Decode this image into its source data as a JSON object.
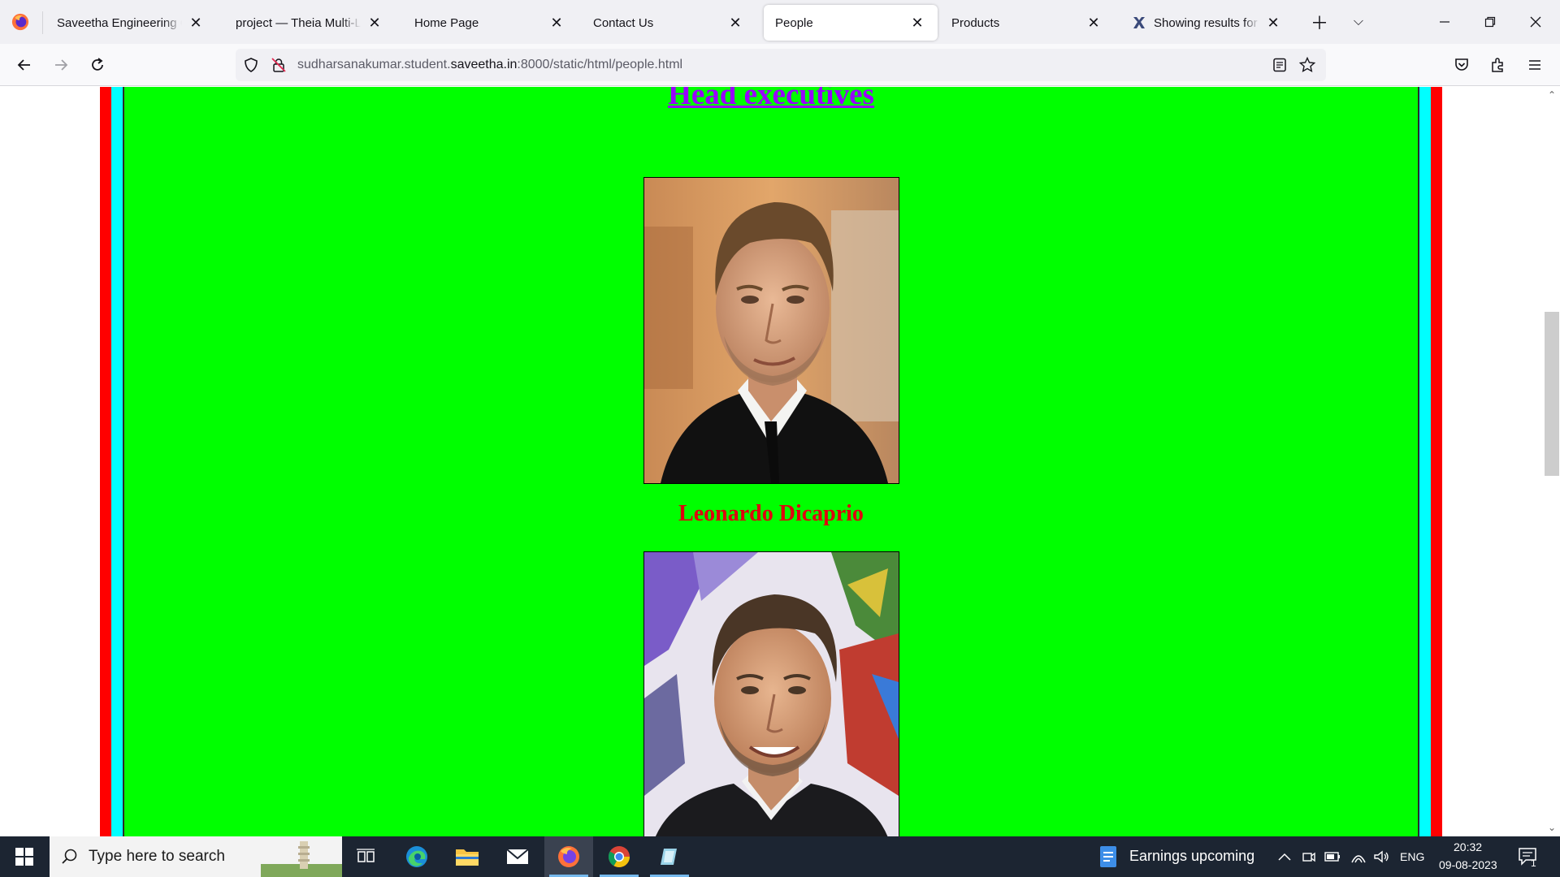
{
  "browser": {
    "tabs": [
      {
        "label": "Saveetha Engineering College",
        "active": false
      },
      {
        "label": "project — Theia Multi-Language",
        "active": false
      },
      {
        "label": "Home Page",
        "active": false
      },
      {
        "label": "Contact Us",
        "active": false
      },
      {
        "label": "People",
        "active": true
      },
      {
        "label": "Products",
        "active": false
      },
      {
        "label": "Showing results for https",
        "active": false
      }
    ],
    "url_prefix": "sudharsanakumar.student.",
    "url_domain": "saveetha.in",
    "url_suffix": ":8000/static/html/people.html"
  },
  "page": {
    "heading": "Head executives",
    "people": [
      {
        "name": "Leonardo Dicaprio"
      },
      {
        "name": ""
      }
    ],
    "colors": {
      "background": "#00ff00",
      "outer_border": "#ff0000",
      "inner_border": "#00ffff",
      "heading": "#9900ff",
      "name": "#e0000f"
    }
  },
  "taskbar": {
    "search_placeholder": "Type here to search",
    "news": "Earnings upcoming",
    "language": "ENG",
    "time": "20:32",
    "date": "09-08-2023",
    "notification_count": "1"
  }
}
